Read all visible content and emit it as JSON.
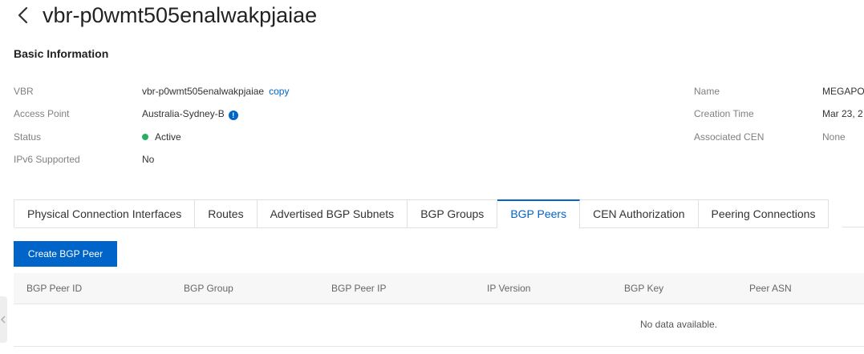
{
  "header": {
    "title": "vbr-p0wmt505enalwakpjaiae"
  },
  "basic_info": {
    "section_title": "Basic Information",
    "left": [
      {
        "label": "VBR",
        "value": "vbr-p0wmt505enalwakpjaiae",
        "action": "copy"
      },
      {
        "label": "Access Point",
        "value": "Australia-Sydney-B",
        "badge": "!"
      },
      {
        "label": "Status",
        "value": "Active"
      },
      {
        "label": "IPv6 Supported",
        "value": "No"
      }
    ],
    "right": [
      {
        "label": "Name",
        "value": "MEGAPO"
      },
      {
        "label": "Creation Time",
        "value": "Mar 23, 2"
      },
      {
        "label": "Associated CEN",
        "value": "None"
      }
    ]
  },
  "tabs": [
    {
      "label": "Physical Connection Interfaces"
    },
    {
      "label": "Routes"
    },
    {
      "label": "Advertised BGP Subnets"
    },
    {
      "label": "BGP Groups"
    },
    {
      "label": "BGP Peers",
      "active": true
    },
    {
      "label": "CEN Authorization"
    },
    {
      "label": "Peering Connections"
    }
  ],
  "toolbar": {
    "create_label": "Create BGP Peer"
  },
  "table": {
    "columns": [
      "BGP Peer ID",
      "BGP Group",
      "BGP Peer IP",
      "IP Version",
      "BGP Key",
      "Peer ASN"
    ],
    "empty_text": "No data available."
  },
  "colors": {
    "primary": "#0064c8",
    "status_active": "#23b066",
    "tab_border": "#e0e0e0"
  },
  "icons": {
    "back": "chevron-left-icon",
    "info": "info-icon",
    "side_handle": "chevron-left-icon"
  }
}
